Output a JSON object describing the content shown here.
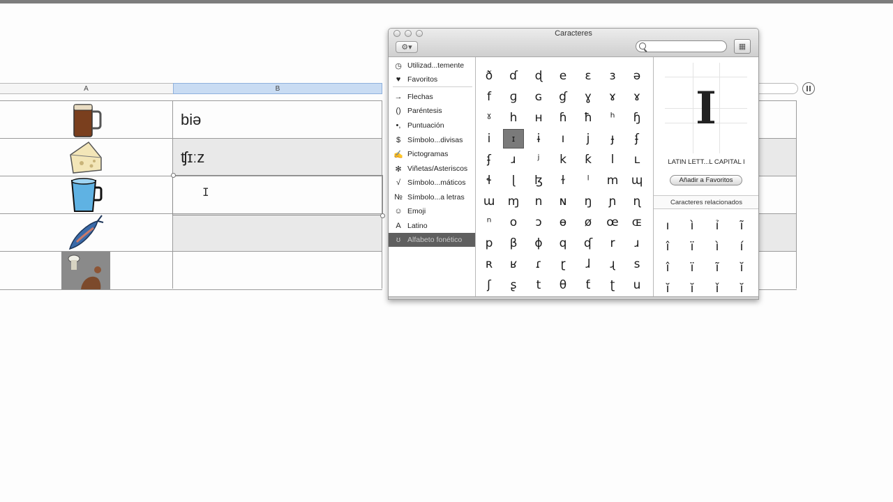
{
  "spreadsheet": {
    "col_a_label": "A",
    "col_b_label": "B",
    "rows": [
      {
        "image": "beer-mug-icon",
        "text": "biə"
      },
      {
        "image": "cheese-icon",
        "text": "ʧɪːz"
      },
      {
        "image": "water-cup-icon",
        "text": ""
      },
      {
        "image": "fish-icon",
        "text": ""
      },
      {
        "image": "food-photo",
        "text": ""
      }
    ]
  },
  "palette": {
    "title": "Caracteres",
    "search_value": "",
    "categories": [
      {
        "icon": "clock-icon",
        "glyph": "◷",
        "label": "Utilizad...temente"
      },
      {
        "icon": "heart-icon",
        "glyph": "♥",
        "label": "Favoritos"
      },
      {
        "icon": "arrow-icon",
        "glyph": "→",
        "label": "Flechas"
      },
      {
        "icon": "parentheses-icon",
        "glyph": "()",
        "label": "Paréntesis"
      },
      {
        "icon": "punctuation-icon",
        "glyph": "•,",
        "label": "Puntuación"
      },
      {
        "icon": "dollar-icon",
        "glyph": "$",
        "label": "Símbolo...divisas"
      },
      {
        "icon": "pictogram-icon",
        "glyph": "✍",
        "label": "Pictogramas"
      },
      {
        "icon": "asterisk-icon",
        "glyph": "✻",
        "label": "Viñetas/Asteriscos"
      },
      {
        "icon": "sqrt-icon",
        "glyph": "√",
        "label": "Símbolo...máticos"
      },
      {
        "icon": "numero-icon",
        "glyph": "№",
        "label": "Símbolo...a letras"
      },
      {
        "icon": "smiley-icon",
        "glyph": "☺",
        "label": "Emoji"
      },
      {
        "icon": "latin-a-icon",
        "glyph": "A",
        "label": "Latino"
      },
      {
        "icon": "phonetic-icon",
        "glyph": "ʊ",
        "label": "Alfabeto fonético"
      }
    ],
    "glyph_rows": [
      [
        "ð",
        "ɗ",
        "ɖ",
        "e",
        "ɛ",
        "ɜ",
        "ə"
      ],
      [
        "f",
        "ɡ",
        "ɢ",
        "ɠ",
        "ɣ",
        "ɤ",
        "ɤ"
      ],
      [
        "ˠ",
        "h",
        "ʜ",
        "ɦ",
        "ħ",
        "ʰ",
        "ɧ"
      ],
      [
        "i",
        "ɪ",
        "ɨ",
        "ı",
        "j",
        "ɟ",
        "ʄ"
      ],
      [
        "ʄ",
        "ɹ",
        "ʲ",
        "k",
        "ƙ",
        "l",
        "ʟ"
      ],
      [
        "ɬ",
        "ɭ",
        "ɮ",
        "ɫ",
        "ˡ",
        "m",
        "ɰ"
      ],
      [
        "ɯ",
        "ɱ",
        "n",
        "ɴ",
        "ŋ",
        "ɲ",
        "ɳ"
      ],
      [
        "ⁿ",
        "o",
        "ɔ",
        "ɵ",
        "ø",
        "œ",
        "ɶ"
      ],
      [
        "p",
        "β",
        "ɸ",
        "q",
        "ʠ",
        "r",
        "ɹ"
      ],
      [
        "ʀ",
        "ʁ",
        "ɾ",
        "ɽ",
        "ɺ",
        "ɻ",
        "s"
      ],
      [
        "ʃ",
        "ʂ",
        "t",
        "θ",
        "ƭ",
        "ʈ",
        "u"
      ]
    ],
    "selected_glyph": "ɪ",
    "preview_glyph": "I",
    "char_name": "LATIN LETT...L CAPITAL I",
    "add_favorites": "Añadir a Favoritos",
    "related_title": "Caracteres relacionados",
    "related": [
      [
        "ı",
        "ì",
        "ỉ",
        "ĩ"
      ],
      [
        "î",
        "ï",
        "ì",
        "í"
      ],
      [
        "î",
        "ï",
        "ĩ",
        "ĭ"
      ],
      [
        "ĭ",
        "ĭ",
        "ǐ",
        "ĭ"
      ]
    ]
  }
}
